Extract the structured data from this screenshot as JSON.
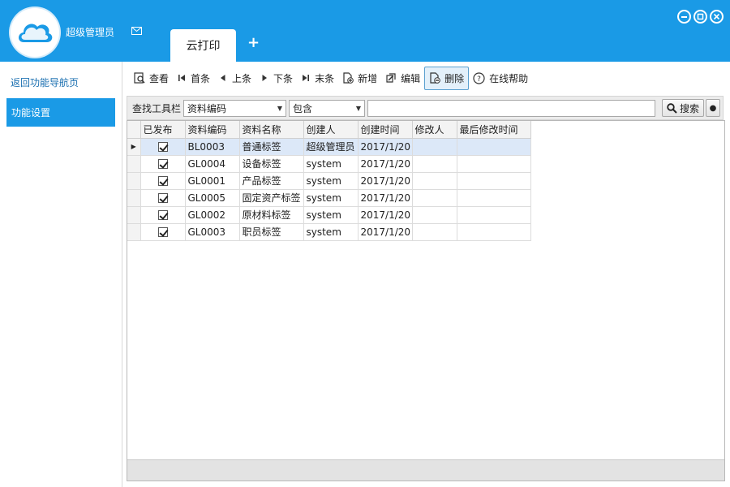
{
  "app": {
    "username": "超级管理员",
    "colors": {
      "primary": "#1a9ae6",
      "selected_row": "#dce8f8"
    }
  },
  "tabs": [
    {
      "label": "云打印",
      "active": true
    }
  ],
  "tab_add_label": "+",
  "sidebar": {
    "back_link": "返回功能导航页",
    "items": [
      {
        "label": "功能设置",
        "active": true
      }
    ]
  },
  "toolbar": {
    "view": "查看",
    "first": "首条",
    "prev": "上条",
    "next": "下条",
    "last": "末条",
    "add": "新增",
    "edit": "编辑",
    "delete": "删除",
    "help": "在线帮助"
  },
  "search": {
    "label": "查找工具栏",
    "field_value": "资料编码",
    "operator_value": "包含",
    "query_value": "",
    "button_label": "搜索"
  },
  "grid": {
    "columns": [
      "已发布",
      "资料编码",
      "资料名称",
      "创建人",
      "创建时间",
      "修改人",
      "最后修改时间"
    ],
    "rows": [
      {
        "published": true,
        "code": "BL0003",
        "name": "普通标签",
        "creator": "超级管理员",
        "created": "2017/1/20",
        "modifier": "",
        "modified": ""
      },
      {
        "published": true,
        "code": "GL0004",
        "name": "设备标签",
        "creator": "system",
        "created": "2017/1/20",
        "modifier": "",
        "modified": ""
      },
      {
        "published": true,
        "code": "GL0001",
        "name": "产品标签",
        "creator": "system",
        "created": "2017/1/20",
        "modifier": "",
        "modified": ""
      },
      {
        "published": true,
        "code": "GL0005",
        "name": "固定资产标签",
        "creator": "system",
        "created": "2017/1/20",
        "modifier": "",
        "modified": ""
      },
      {
        "published": true,
        "code": "GL0002",
        "name": "原材料标签",
        "creator": "system",
        "created": "2017/1/20",
        "modifier": "",
        "modified": ""
      },
      {
        "published": true,
        "code": "GL0003",
        "name": "职员标签",
        "creator": "system",
        "created": "2017/1/20",
        "modifier": "",
        "modified": ""
      }
    ]
  }
}
